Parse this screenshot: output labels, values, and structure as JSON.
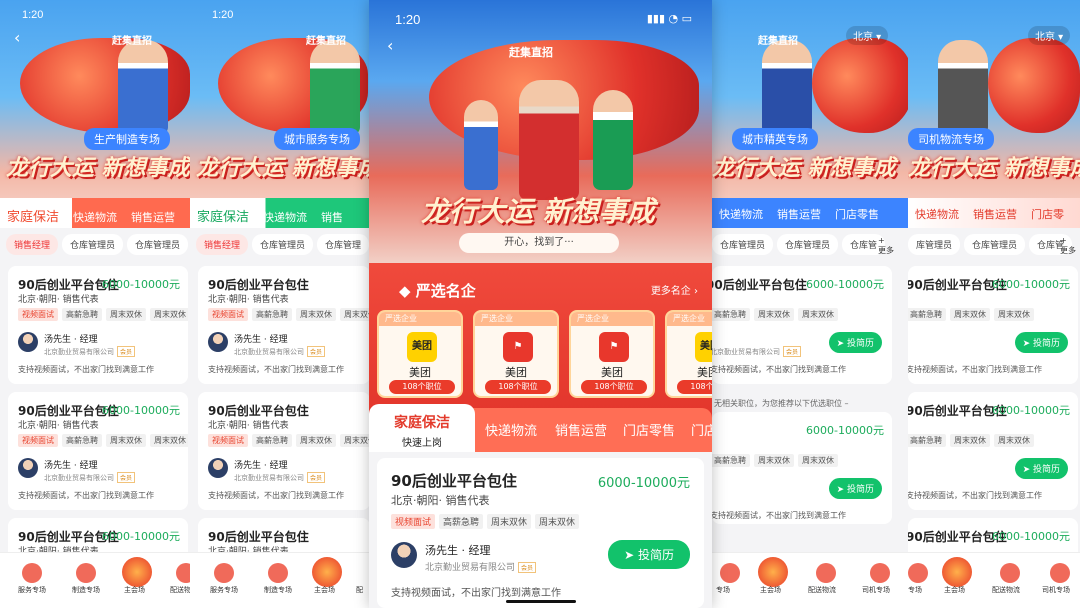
{
  "screens": [
    {
      "time": "1:20",
      "brand": "赶集直招",
      "badge": "生产制造专场",
      "slogan": "龙行大运 新想事成",
      "tabs": [
        "家庭保洁",
        "快递物流",
        "销售运营"
      ],
      "chips": [
        "销售经理",
        "仓库管理员",
        "仓库管理员"
      ],
      "tabbar": [
        "服务专场",
        "制造专场",
        "主会场",
        "配送物"
      ]
    },
    {
      "time": "1:20",
      "brand": "赶集直招",
      "badge": "城市服务专场",
      "slogan": "龙行大运 新想事成",
      "tabs": [
        "家庭保洁",
        "快递物流",
        "销售"
      ],
      "chips": [
        "销售经理",
        "仓库管理员",
        "仓库管理"
      ],
      "tabbar": [
        "服务专场",
        "制造专场",
        "主会场",
        "配"
      ]
    },
    {
      "time": "1:20",
      "brand": "赶集直招",
      "slogan": "龙行大运 新想事成",
      "sub": "开心，找到了···",
      "section": "严选名企",
      "more": "更多名企",
      "companies": [
        {
          "tag": "严选企业",
          "name": "美团",
          "jobs": "108个职位"
        },
        {
          "tag": "严选企业",
          "name": "美团",
          "jobs": "108个职位"
        },
        {
          "tag": "严选企业",
          "name": "美团",
          "jobs": "108个职位"
        },
        {
          "tag": "严选企业",
          "name": "美团",
          "jobs": "108个职位"
        }
      ],
      "tab_active": "家庭保洁",
      "tab_active_sub": "快速上岗",
      "tabs": [
        "快递物流",
        "销售运营",
        "门店零售",
        "门店"
      ]
    },
    {
      "brand": "赶集直招",
      "city": "北京",
      "badge": "城市精英专场",
      "slogan": "龙行大运 新想事成",
      "tabs": [
        "快递物流",
        "销售运营",
        "门店零售"
      ],
      "chips": [
        "仓库管理员",
        "仓库管理员",
        "仓库管"
      ],
      "more": "更多",
      "empty_note": "无相关职位，为您推荐以下优选职位 –",
      "tabbar": [
        "专场",
        "主会场",
        "配送物流",
        "司机专场"
      ]
    },
    {
      "brand": "",
      "city": "北京",
      "badge": "司机物流专场",
      "slogan": "龙行大运 新想事成",
      "tabs": [
        "快递物流",
        "销售运营",
        "门店零"
      ],
      "chips": [
        "库管理员",
        "仓库管理员",
        "仓库管"
      ],
      "more": "更多",
      "tabbar": [
        "专场",
        "主会场",
        "配送物流",
        "司机专场"
      ]
    }
  ],
  "job": {
    "title": "90后创业平台包住",
    "salary": "6000-10000元",
    "location": "北京·朝阳· 销售代表",
    "tags": [
      "视频面试",
      "高薪急聘",
      "周末双休",
      "周末双休"
    ],
    "recruiter": "汤先生 · 经理",
    "company": "北京勤业贸易有限公司",
    "vip": "会员",
    "apply": "投简历",
    "note": "支持视频面试，不出家门找到满意工作"
  },
  "colors": {
    "accent": "#e33a2b",
    "apply": "#12c26b",
    "badge": "#3c84ff"
  }
}
